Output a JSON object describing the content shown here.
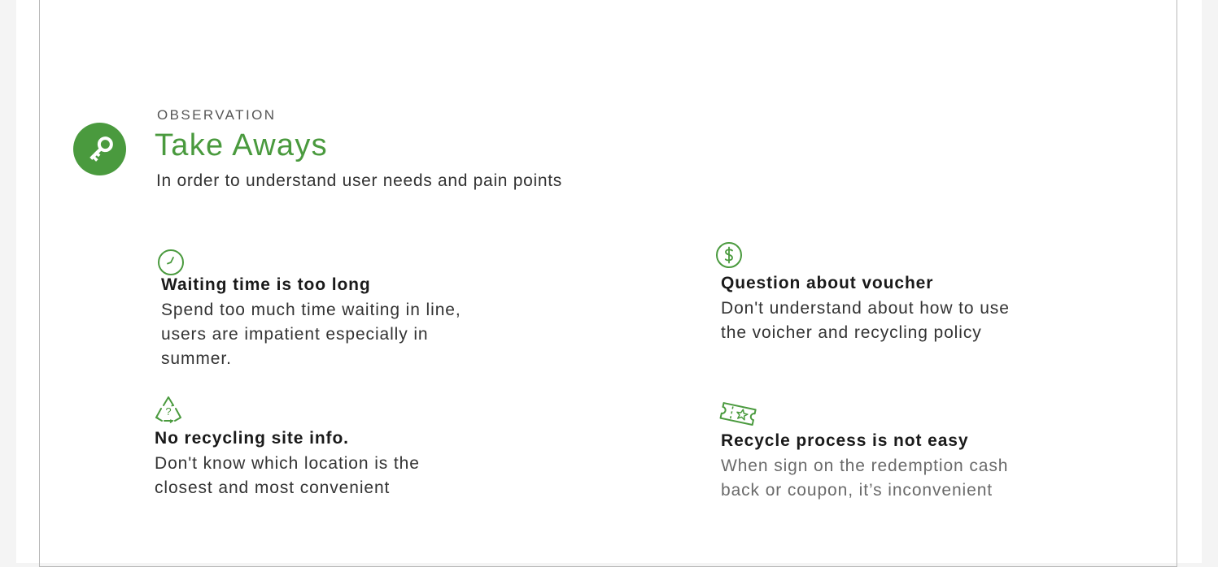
{
  "header": {
    "eyebrow": "OBSERVATION",
    "title": "Take Aways",
    "subtitle": "In order to understand user needs and pain points",
    "badge_icon": "key-icon"
  },
  "colors": {
    "accent": "#4a9a3e",
    "heading": "#1a1a1a",
    "body": "#333333",
    "muted": "#6a6a6a"
  },
  "cards": [
    {
      "icon": "clock-icon",
      "heading": "Waiting time is too long",
      "body_lines": [
        "Spend too much time waiting in line,",
        "users are impatient especially in",
        "summer."
      ]
    },
    {
      "icon": "dollar-icon",
      "heading": "Question about voucher",
      "body_lines": [
        "Don't understand about how to use",
        "the voicher and recycling policy"
      ]
    },
    {
      "icon": "recycle-question-icon",
      "heading": "No recycling site info.",
      "body_lines": [
        "Don't know which location is the",
        "closest and most convenient"
      ]
    },
    {
      "icon": "coupon-ticket-icon",
      "heading": "Recycle process is not easy",
      "body_lines": [
        "When sign on the redemption cash",
        "back or coupon, it’s inconvenient"
      ]
    }
  ]
}
